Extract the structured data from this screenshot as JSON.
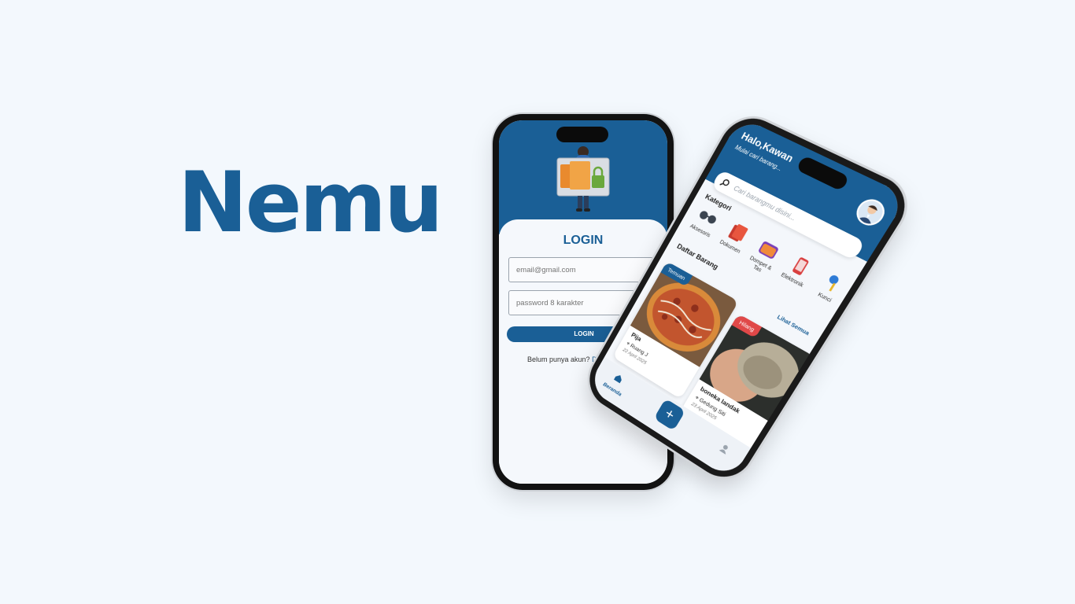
{
  "brand": {
    "title": "Nemu"
  },
  "login": {
    "title": "LOGIN",
    "email_placeholder": "email@gmail.com",
    "password_placeholder": "password 8 karakter",
    "button": "LOGIN",
    "no_account": "Belum punya akun?",
    "signup_link": "Daftar"
  },
  "home": {
    "greeting": "Halo,Kawan",
    "subtitle": "Mulai cari barang...",
    "search_placeholder": "Cari barangmu disini...",
    "categories_title": "Kategori",
    "categories": [
      {
        "label": "Aksesoris",
        "icon": "glasses-icon"
      },
      {
        "label": "Dokumen",
        "icon": "document-icon"
      },
      {
        "label": "Dompet & Tas",
        "icon": "wallet-icon"
      },
      {
        "label": "Elektronik",
        "icon": "phone-icon"
      },
      {
        "label": "Kunci",
        "icon": "key-icon"
      }
    ],
    "items_title": "Daftar Barang",
    "see_all": "Lihat Semua",
    "items": [
      {
        "badge": "Temuan",
        "name": "Pija",
        "location": "Ruang J",
        "date": "22 April 2025"
      },
      {
        "badge": "Hilang",
        "name": "boneka landak",
        "location": "Gedung Siti",
        "date": "23 April 2025"
      }
    ],
    "nav": {
      "home": "Beranda",
      "add": "+"
    }
  },
  "colors": {
    "primary": "#1a5f96",
    "lost": "#e04848",
    "background": "#f3f8fd"
  }
}
